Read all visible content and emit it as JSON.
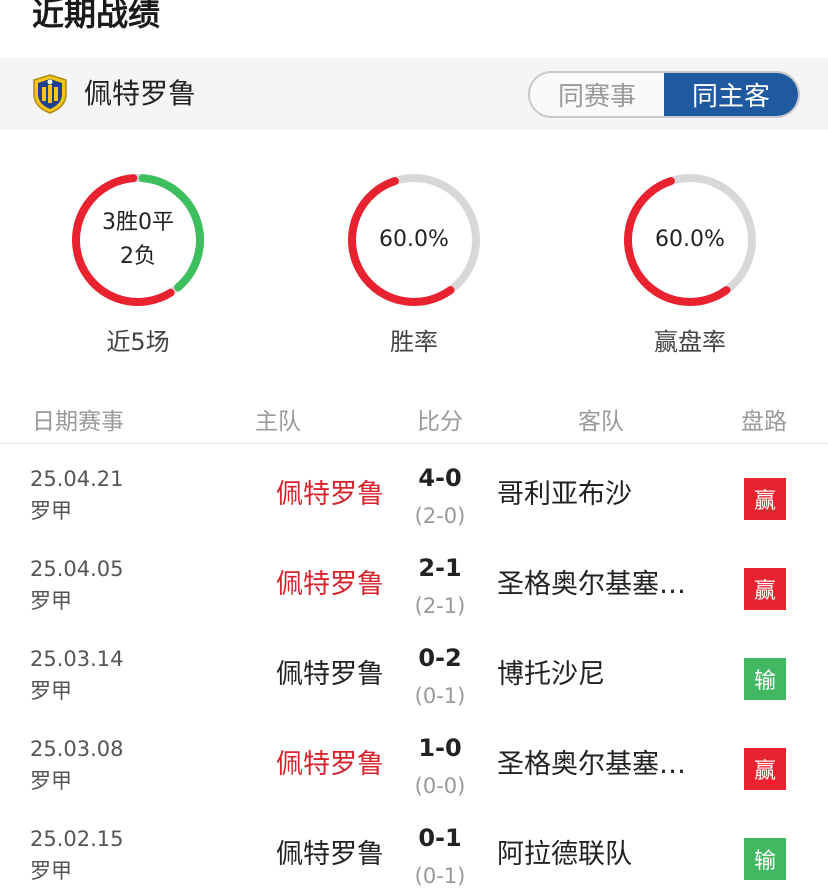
{
  "section_title": "近期战绩",
  "team": {
    "name": "佩特罗鲁",
    "logo_icon": "team-crest-icon"
  },
  "filters": [
    {
      "label": "同赛事",
      "active": false
    },
    {
      "label": "同主客",
      "active": true
    }
  ],
  "colors": {
    "win": "#e8222e",
    "draw": "#d8d8d8",
    "loss": "#3cbf5c",
    "active_tab": "#1f5aa0",
    "win_badge": "#e8222e",
    "loss_badge": "#43b862"
  },
  "summary": [
    {
      "line1": "3胜0平",
      "line2": "2负",
      "label": "近5场",
      "wins": 3,
      "draws": 0,
      "losses": 2
    },
    {
      "value": "60.0%",
      "label": "胜率",
      "fraction": 0.6
    },
    {
      "value": "60.0%",
      "label": "赢盘率",
      "fraction": 0.6
    }
  ],
  "table": {
    "headers": [
      "日期赛事",
      "主队",
      "比分",
      "客队",
      "盘路"
    ],
    "rows": [
      {
        "date": "25.04.21",
        "league": "罗甲",
        "home": "佩特罗鲁",
        "home_highlight": true,
        "score": "4-0",
        "half": "(2-0)",
        "away": "哥利亚布沙",
        "result": "赢"
      },
      {
        "date": "25.04.05",
        "league": "罗甲",
        "home": "佩特罗鲁",
        "home_highlight": true,
        "score": "2-1",
        "half": "(2-1)",
        "away": "圣格奥尔基塞…",
        "result": "赢"
      },
      {
        "date": "25.03.14",
        "league": "罗甲",
        "home": "佩特罗鲁",
        "home_highlight": false,
        "score": "0-2",
        "half": "(0-1)",
        "away": "博托沙尼",
        "result": "输"
      },
      {
        "date": "25.03.08",
        "league": "罗甲",
        "home": "佩特罗鲁",
        "home_highlight": true,
        "score": "1-0",
        "half": "(0-0)",
        "away": "圣格奥尔基塞…",
        "result": "赢"
      },
      {
        "date": "25.02.15",
        "league": "罗甲",
        "home": "佩特罗鲁",
        "home_highlight": false,
        "score": "0-1",
        "half": "(0-1)",
        "away": "阿拉德联队",
        "result": "输"
      }
    ]
  }
}
